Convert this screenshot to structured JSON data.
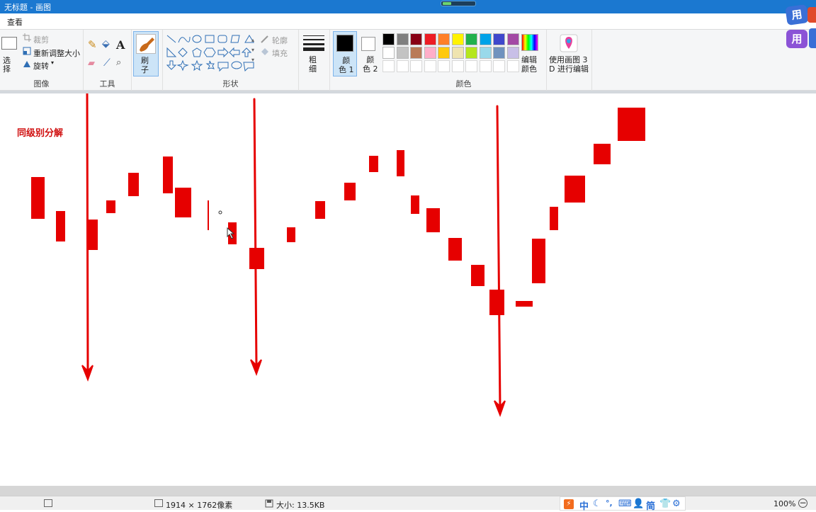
{
  "window": {
    "title": "无标题 - 画图"
  },
  "menu": {
    "view": "查看"
  },
  "ribbon": {
    "image": {
      "select": "选\n择",
      "crop": "裁剪",
      "resize": "重新调整大小",
      "rotate": "旋转",
      "label": "图像"
    },
    "tools": {
      "label": "工具"
    },
    "brush": {
      "label": "刷\n子"
    },
    "shapes": {
      "outline": "轮廓",
      "fill": "填充",
      "label": "形状"
    },
    "size": {
      "label": "粗\n细"
    },
    "color1": {
      "label": "颜\n色 1"
    },
    "color2": {
      "label": "颜\n色 2"
    },
    "colors": {
      "label": "颜色",
      "row1": [
        "#000000",
        "#7f7f7f",
        "#880015",
        "#ed1c24",
        "#ff7f27",
        "#fff200",
        "#22b14c",
        "#00a2e8",
        "#3f48cc",
        "#a349a4"
      ],
      "row2": [
        "#ffffff",
        "#c3c3c3",
        "#b97a57",
        "#ffaec9",
        "#ffc90e",
        "#efe4b0",
        "#b5e61d",
        "#99d9ea",
        "#7092be",
        "#c8bfe7"
      ]
    },
    "edit_colors": {
      "label": "编辑\n颜色"
    },
    "paint3d": {
      "label": "使用画图 3\nD 进行编辑"
    }
  },
  "canvas": {
    "annotation": "同级别分解",
    "red": "#e60000"
  },
  "status": {
    "dimensions": "1914 × 1762像素",
    "size": "大小: 13.5KB",
    "zoom": "100%"
  },
  "ime": {
    "chars": [
      "中",
      "简"
    ]
  },
  "floating": {
    "a": "用",
    "b": "用"
  }
}
